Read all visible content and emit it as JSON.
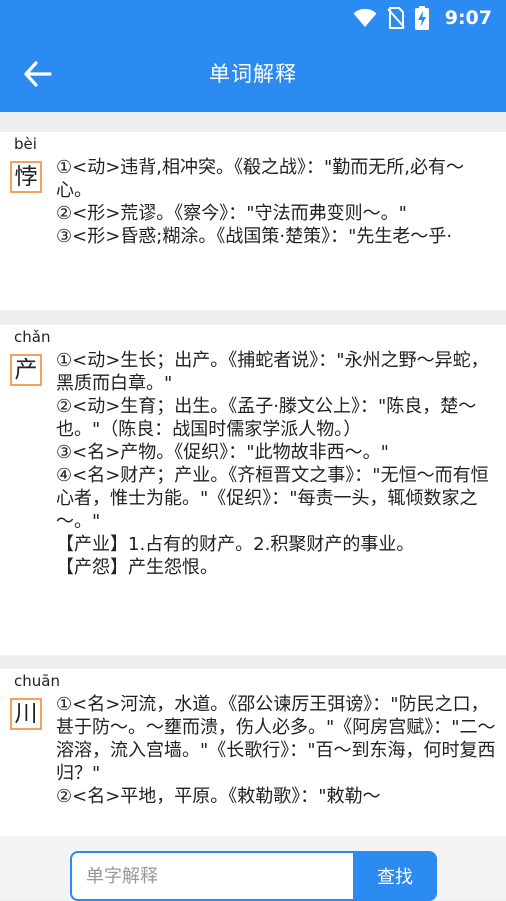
{
  "status_bar": {
    "time": "9:07",
    "icons": [
      "wifi-icon",
      "no-sim-icon",
      "battery-charging-icon"
    ]
  },
  "app_bar": {
    "title": "单词解释",
    "back_icon": "arrow-left-icon"
  },
  "entries": [
    {
      "pinyin": "bèi",
      "char": "悖",
      "defs": [
        "①<动>违背,相冲突。《殽之战》：\"勤而无所,必有～心。",
        "②<形>荒谬。《察今》：\"守法而弗变则～。\"",
        "③<形>昏惑;糊涂。《战国策·楚策》：\"先生老～乎·"
      ]
    },
    {
      "pinyin": "chǎn",
      "char": "产",
      "defs": [
        "①<动>生长；出产。《捕蛇者说》：\"永州之野～异蛇，黑质而白章。\"",
        "②<动>生育；出生。《孟子·滕文公上》：\"陈良，楚～也。\"（陈良：战国时儒家学派人物。）",
        "③<名>产物。《促织》：\"此物故非西～。\"",
        "④<名>财产；产业。《齐桓晋文之事》：\"无恒～而有恒心者，惟士为能。\"《促织》：\"每责一头，辄倾数家之～。\"",
        "【产业】1.占有的财产。2.积聚财产的事业。",
        "【产怨】产生怨恨。"
      ]
    },
    {
      "pinyin": "chuān",
      "char": "川",
      "defs": [
        "①<名>河流，水道。《邵公谏厉王弭谤》：\"防民之口，甚于防～。～壅而溃，伤人必多。\"《阿房宫赋》：\"二～溶溶，流入宫墙。\"《长歌行》：\"百～到东海，何时复西归？\"",
        "②<名>平地，平原。《敕勒歌》：\"敕勒～"
      ]
    }
  ],
  "search": {
    "placeholder": "单字解释",
    "value": "",
    "button_label": "查找"
  }
}
